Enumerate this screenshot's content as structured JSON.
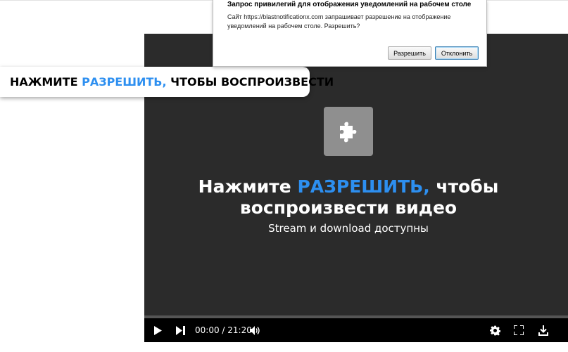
{
  "dialog": {
    "title": "Запрос привилегий для отображения уведомлений на рабочем столе",
    "message": "Сайт https://blastnotificationx.com запрашивает разрешение на отображение уведомлений на рабочем столе. Разрешить?",
    "allow_label": "Разрешить",
    "deny_label": "Отклонить"
  },
  "banner": {
    "prefix": "НАЖМИТЕ ",
    "accent": "РАЗРЕШИТЬ,",
    "suffix": " ЧТОБЫ ВОСПРОИЗВЕСТИ"
  },
  "player": {
    "plugin_icon": "puzzle-piece-icon",
    "headline_prefix": "Нажмите ",
    "headline_accent": "РАЗРЕШИТЬ,",
    "headline_line1_suffix": " чтобы",
    "headline_line2": "воспроизвести видео",
    "subtitle": "Stream и download доступны",
    "time_display": "00:00 / 21:20",
    "controls": [
      "play-icon",
      "next-icon",
      "volume-icon",
      "settings-icon",
      "fullscreen-icon",
      "download-icon"
    ]
  },
  "colors": {
    "accent": "#2d8ff0",
    "player_bg": "#2b2b2b",
    "controls_bg": "#000000"
  }
}
